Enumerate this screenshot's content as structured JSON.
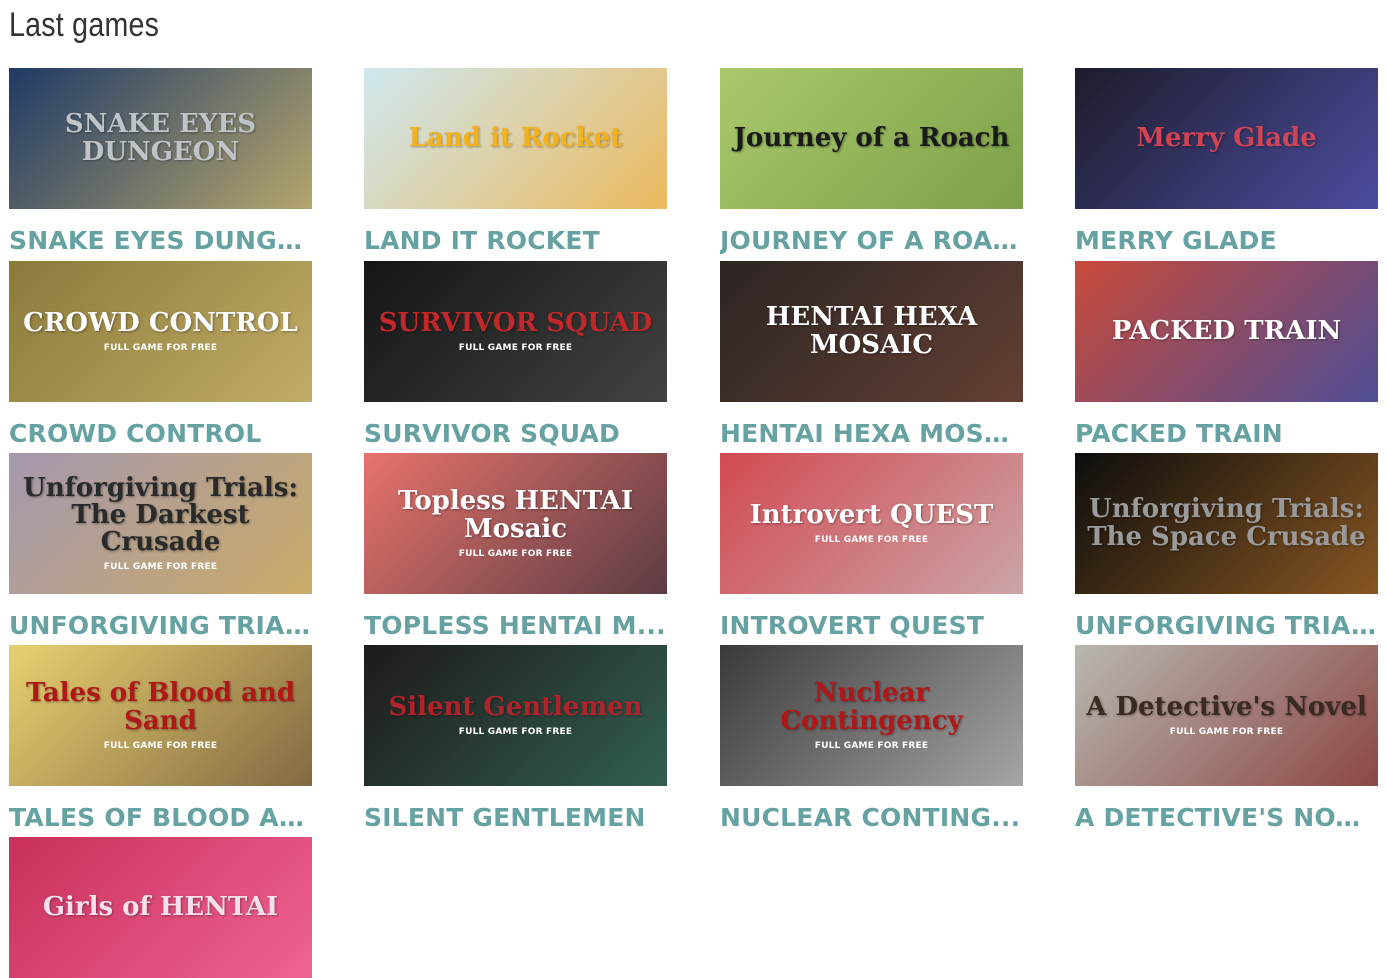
{
  "page_title": "Last games",
  "games": [
    {
      "title": "SNAKE EYES DUNGE...",
      "art_text": "SNAKE EYES DUNGEON",
      "badge": "",
      "bg": "#1f3a66",
      "fg": "#bfc4c8",
      "accent": "#f0d070"
    },
    {
      "title": "LAND IT ROCKET",
      "art_text": "Land it Rocket",
      "badge": "",
      "bg": "#cfe8f0",
      "fg": "#f3b21c",
      "accent": "#f6a623"
    },
    {
      "title": "JOURNEY OF A ROAC...",
      "art_text": "Journey of a Roach",
      "badge": "",
      "bg": "#a9c96b",
      "fg": "#1a1a1a",
      "accent": "#6b8f3a"
    },
    {
      "title": "MERRY GLADE",
      "art_text": "Merry Glade",
      "badge": "",
      "bg": "#1c1c2a",
      "fg": "#d04455",
      "accent": "#6060d0"
    },
    {
      "title": "CROWD CONTROL",
      "art_text": "CROWD CONTROL",
      "badge": "FULL GAME FOR FREE",
      "bg": "#8a7a3a",
      "fg": "#ffffff",
      "accent": "#d9c07a"
    },
    {
      "title": "SURVIVOR SQUAD",
      "art_text": "SURVIVOR SQUAD",
      "badge": "FULL GAME FOR FREE",
      "bg": "#151515",
      "fg": "#c0282a",
      "accent": "#555555"
    },
    {
      "title": "HENTAI HEXA MOSA...",
      "art_text": "HENTAI HEXA MOSAIC",
      "badge": "",
      "bg": "#2b2523",
      "fg": "#ffffff",
      "accent": "#7a4a3a"
    },
    {
      "title": "PACKED TRAIN",
      "art_text": "PACKED TRAIN",
      "badge": "",
      "bg": "#c84a3a",
      "fg": "#ffffff",
      "accent": "#1d4fb8"
    },
    {
      "title": "UNFORGIVING TRIA...",
      "art_text": "Unforgiving Trials: The Darkest Crusade",
      "badge": "FULL GAME FOR FREE",
      "bg": "#a598b0",
      "fg": "#2a2a2a",
      "accent": "#d8b24a"
    },
    {
      "title": "TOPLESS HENTAI M...",
      "art_text": "Topless HENTAI Mosaic",
      "badge": "FULL GAME FOR FREE",
      "bg": "#e8736c",
      "fg": "#ffffff",
      "accent": "#232633"
    },
    {
      "title": "INTROVERT QUEST",
      "art_text": "Introvert QUEST",
      "badge": "FULL GAME FOR FREE",
      "bg": "#d24a52",
      "fg": "#ffffff",
      "accent": "#c9c9c9"
    },
    {
      "title": "UNFORGIVING TRIA...",
      "art_text": "Unforgiving Trials: The Space Crusade",
      "badge": "",
      "bg": "#0d0d0d",
      "fg": "#9a9a9a",
      "accent": "#b8732a"
    },
    {
      "title": "TALES OF BLOOD AN...",
      "art_text": "Tales of Blood and Sand",
      "badge": "FULL GAME FOR FREE",
      "bg": "#e8d070",
      "fg": "#b01818",
      "accent": "#5a4030"
    },
    {
      "title": "SILENT GENTLEMEN",
      "art_text": "Silent Gentlemen",
      "badge": "FULL GAME FOR FREE",
      "bg": "#1e1a18",
      "fg": "#b0232a",
      "accent": "#3a7a6a"
    },
    {
      "title": "NUCLEAR CONTING...",
      "art_text": "Nuclear Contingency",
      "badge": "FULL GAME FOR FREE",
      "bg": "#3a3a3a",
      "fg": "#b01818",
      "accent": "#d0d0d0"
    },
    {
      "title": "A DETECTIVE'S NOVEL",
      "art_text": "A Detective's Novel",
      "badge": "FULL GAME FOR FREE",
      "bg": "#b8b8b0",
      "fg": "#3a2a20",
      "accent": "#7a1a1a"
    },
    {
      "title": "",
      "art_text": "Girls of HENTAI",
      "badge": "",
      "bg": "#c8305a",
      "fg": "#f5e0ec",
      "accent": "#ff77aa"
    }
  ]
}
